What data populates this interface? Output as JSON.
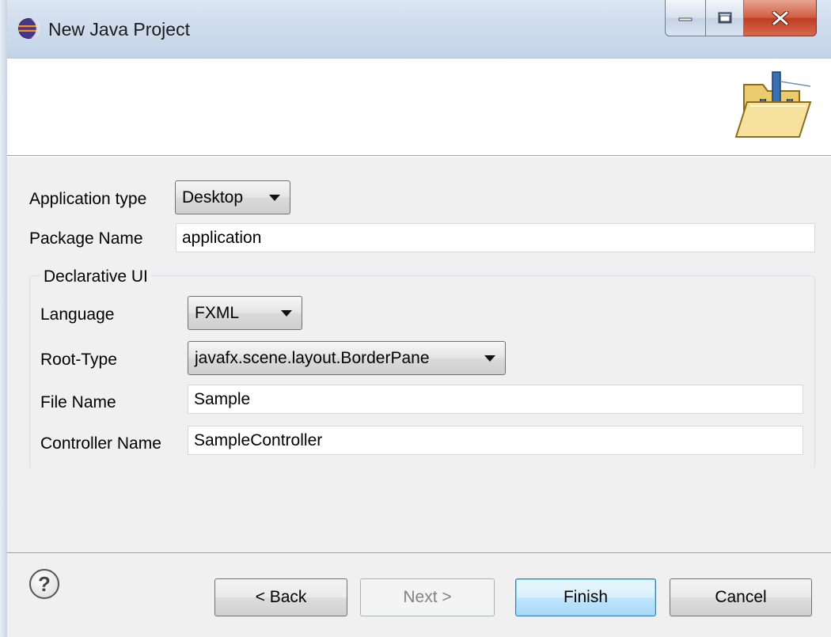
{
  "window": {
    "title": "New Java Project",
    "buttons": {
      "minimize": "minimize",
      "maximize": "maximize",
      "close": "close"
    }
  },
  "form": {
    "application_type_label": "Application type",
    "application_type_value": "Desktop",
    "package_name_label": "Package Name",
    "package_name_value": "application",
    "group_title": "Declarative UI",
    "language_label": "Language",
    "language_value": "FXML",
    "root_type_label": "Root-Type",
    "root_type_value": "javafx.scene.layout.BorderPane",
    "file_name_label": "File Name",
    "file_name_value": "Sample",
    "controller_name_label": "Controller Name",
    "controller_name_value": "SampleController"
  },
  "footer": {
    "help_glyph": "?",
    "back_label": "< Back",
    "next_label": "Next >",
    "finish_label": "Finish",
    "cancel_label": "Cancel"
  },
  "icons": {
    "title_icon": "eclipse-icon",
    "banner_icon": "java-project-folder-icon",
    "help_icon": "help-icon"
  },
  "colors": {
    "accent_default_button": "#3c7fb1",
    "dialog_background": "#f0f0f0",
    "titlebar": "#cfdcec"
  }
}
